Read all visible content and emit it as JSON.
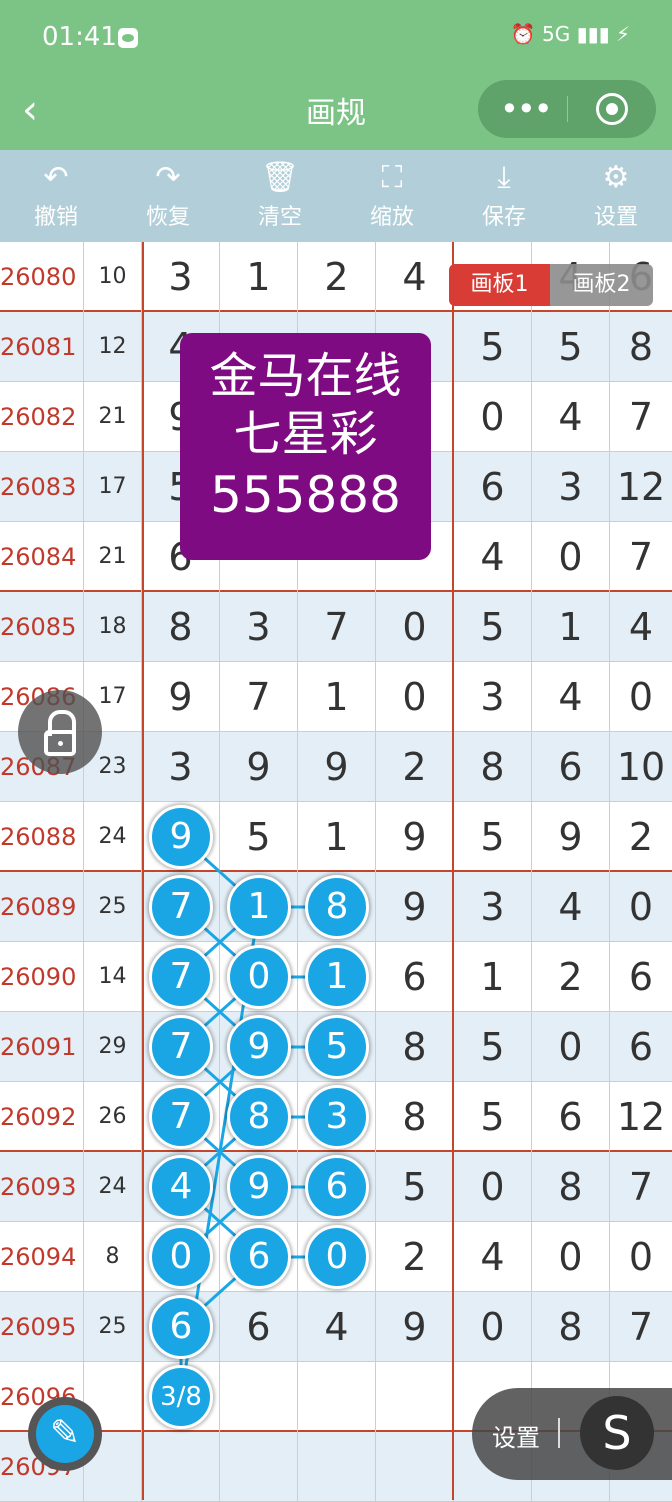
{
  "status_bar": {
    "time": "01:41",
    "network": "5G"
  },
  "header": {
    "title": "画规",
    "back": "‹",
    "menu_dots": "•••"
  },
  "toolbar": [
    {
      "label": "撤销",
      "icon": "undo-icon",
      "glyph": "↶"
    },
    {
      "label": "恢复",
      "icon": "redo-icon",
      "glyph": "↷"
    },
    {
      "label": "清空",
      "icon": "trash-icon",
      "glyph": "🗑"
    },
    {
      "label": "缩放",
      "icon": "zoom-icon",
      "glyph": "⛶"
    },
    {
      "label": "保存",
      "icon": "download-icon",
      "glyph": "⤓"
    },
    {
      "label": "设置",
      "icon": "gear-icon",
      "glyph": "⚙"
    }
  ],
  "rows": [
    {
      "id": "26080",
      "sum": "10",
      "d": [
        "3",
        "1",
        "2",
        "4",
        "",
        "4",
        "6"
      ]
    },
    {
      "id": "26081",
      "sum": "12",
      "d": [
        "4",
        "",
        "",
        "",
        "5",
        "5",
        "8"
      ]
    },
    {
      "id": "26082",
      "sum": "21",
      "d": [
        "9",
        "",
        "",
        "",
        "0",
        "4",
        "7"
      ]
    },
    {
      "id": "26083",
      "sum": "17",
      "d": [
        "5",
        "",
        "",
        "",
        "6",
        "3",
        "12"
      ]
    },
    {
      "id": "26084",
      "sum": "21",
      "d": [
        "6",
        "",
        "",
        "",
        "4",
        "0",
        "7"
      ]
    },
    {
      "id": "26085",
      "sum": "18",
      "d": [
        "8",
        "3",
        "7",
        "0",
        "5",
        "1",
        "4"
      ]
    },
    {
      "id": "26086",
      "sum": "17",
      "d": [
        "9",
        "7",
        "1",
        "0",
        "3",
        "4",
        "0"
      ]
    },
    {
      "id": "26087",
      "sum": "23",
      "d": [
        "3",
        "9",
        "9",
        "2",
        "8",
        "6",
        "10"
      ]
    },
    {
      "id": "26088",
      "sum": "24",
      "d": [
        "9",
        "5",
        "1",
        "9",
        "5",
        "9",
        "2"
      ]
    },
    {
      "id": "26089",
      "sum": "25",
      "d": [
        "7",
        "1",
        "8",
        "9",
        "3",
        "4",
        "0"
      ]
    },
    {
      "id": "26090",
      "sum": "14",
      "d": [
        "7",
        "0",
        "1",
        "6",
        "1",
        "2",
        "6"
      ]
    },
    {
      "id": "26091",
      "sum": "29",
      "d": [
        "7",
        "9",
        "5",
        "8",
        "5",
        "0",
        "6"
      ]
    },
    {
      "id": "26092",
      "sum": "26",
      "d": [
        "7",
        "8",
        "3",
        "8",
        "5",
        "6",
        "12"
      ]
    },
    {
      "id": "26093",
      "sum": "24",
      "d": [
        "4",
        "9",
        "6",
        "5",
        "0",
        "8",
        "7"
      ]
    },
    {
      "id": "26094",
      "sum": "8",
      "d": [
        "0",
        "6",
        "0",
        "2",
        "4",
        "0",
        "0"
      ]
    },
    {
      "id": "26095",
      "sum": "25",
      "d": [
        "6",
        "6",
        "4",
        "9",
        "0",
        "8",
        "7"
      ]
    },
    {
      "id": "26096",
      "sum": "",
      "d": [
        "3/8",
        "",
        "",
        "",
        "",
        "",
        ""
      ]
    },
    {
      "id": "26097",
      "sum": "",
      "d": [
        "",
        "",
        "",
        "",
        "",
        "",
        ""
      ]
    }
  ],
  "bubbles": [
    {
      "row": 8,
      "col": 0,
      "text": "9"
    },
    {
      "row": 9,
      "col": 0,
      "text": "7"
    },
    {
      "row": 9,
      "col": 1,
      "text": "1"
    },
    {
      "row": 9,
      "col": 2,
      "text": "8"
    },
    {
      "row": 10,
      "col": 0,
      "text": "7"
    },
    {
      "row": 10,
      "col": 1,
      "text": "0"
    },
    {
      "row": 10,
      "col": 2,
      "text": "1"
    },
    {
      "row": 11,
      "col": 0,
      "text": "7"
    },
    {
      "row": 11,
      "col": 1,
      "text": "9"
    },
    {
      "row": 11,
      "col": 2,
      "text": "5"
    },
    {
      "row": 12,
      "col": 0,
      "text": "7"
    },
    {
      "row": 12,
      "col": 1,
      "text": "8"
    },
    {
      "row": 12,
      "col": 2,
      "text": "3"
    },
    {
      "row": 13,
      "col": 0,
      "text": "4"
    },
    {
      "row": 13,
      "col": 1,
      "text": "9"
    },
    {
      "row": 13,
      "col": 2,
      "text": "6"
    },
    {
      "row": 14,
      "col": 0,
      "text": "0"
    },
    {
      "row": 14,
      "col": 1,
      "text": "6"
    },
    {
      "row": 14,
      "col": 2,
      "text": "0"
    },
    {
      "row": 15,
      "col": 0,
      "text": "6"
    },
    {
      "row": 16,
      "col": 0,
      "text": "3/8"
    }
  ],
  "promo": {
    "line1": "金马在线",
    "line2": "七星彩",
    "line3": "555888"
  },
  "boards": {
    "board1": "画板1",
    "board2": "画板2"
  },
  "bottom": {
    "settings_label": "设置",
    "s_glyph": "S",
    "pen_glyph": "✎"
  },
  "colors": {
    "header_green": "#7cc486",
    "toolbar_blue": "#b2cfd9",
    "bubble_blue": "#1aa6e4",
    "promo_purple": "#7f0b82",
    "id_red": "#c0392b"
  }
}
